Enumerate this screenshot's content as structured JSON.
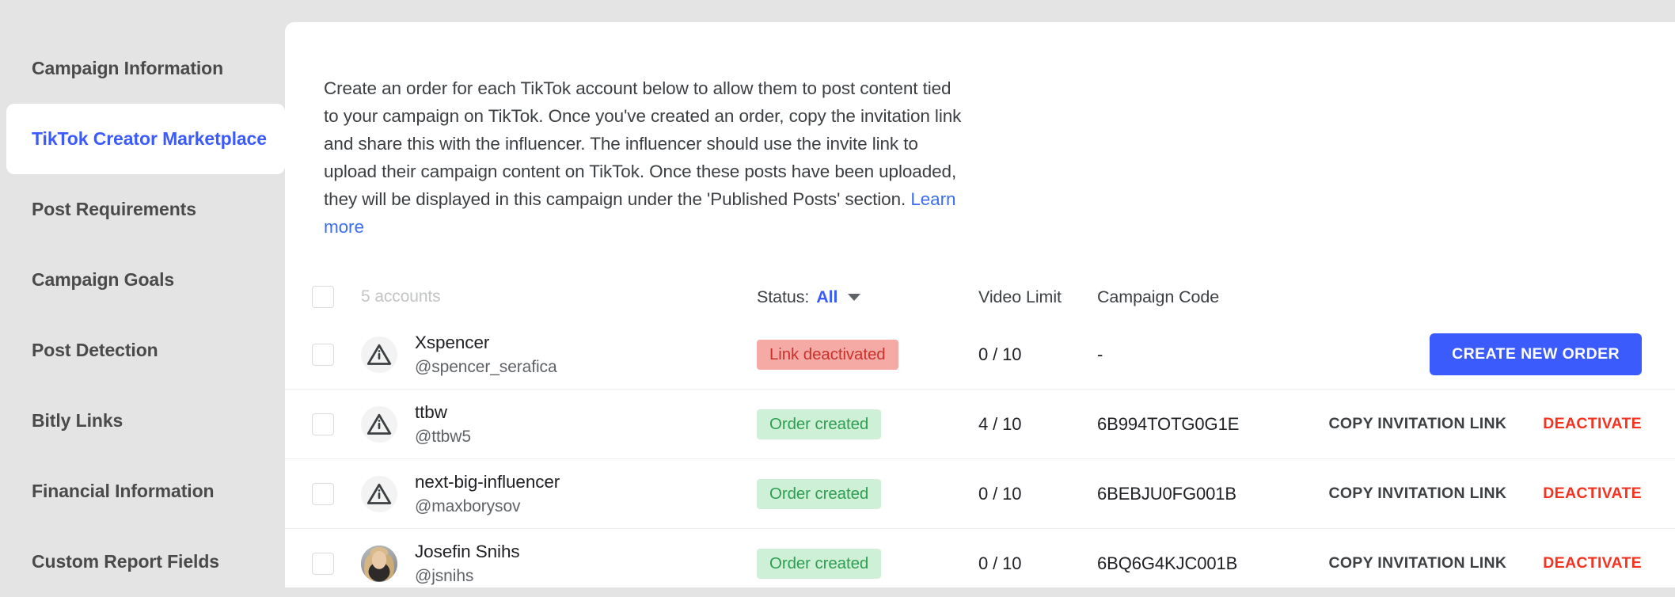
{
  "theme": {
    "accent": "#3b5bfd",
    "danger": "#f4321f",
    "link": "#3b6ef0",
    "page_bg": "#e4e4e4",
    "panel_bg": "#ffffff",
    "status_red_bg": "#f6aaa6",
    "status_red_text": "#c7322b",
    "status_green_bg": "#cdf0d7",
    "status_green_text": "#2f9e52"
  },
  "sidebar": {
    "items": [
      {
        "label": "Campaign Information",
        "active": false
      },
      {
        "label": "TikTok Creator Marketplace",
        "active": true
      },
      {
        "label": "Post Requirements",
        "active": false
      },
      {
        "label": "Campaign Goals",
        "active": false
      },
      {
        "label": "Post Detection",
        "active": false
      },
      {
        "label": "Bitly Links",
        "active": false
      },
      {
        "label": "Financial Information",
        "active": false
      },
      {
        "label": "Custom Report Fields",
        "active": false
      }
    ]
  },
  "main": {
    "intro": {
      "text": "Create an order for each TikTok account below to allow them to post content tied to your campaign on TikTok. Once you've created an order, copy the invitation link and share this with the influencer. The influencer should use the invite link to upload their campaign content on TikTok. Once these posts have been uploaded, they will be displayed in this campaign under the 'Published Posts' section. ",
      "link_label": "Learn more"
    },
    "table": {
      "header": {
        "account_count": "5 accounts",
        "status_label": "Status:",
        "status_value": "All",
        "video_limit": "Video Limit",
        "campaign_code": "Campaign Code"
      },
      "actions": {
        "create_new_order": "CREATE NEW ORDER",
        "copy_invitation_link": "COPY INVITATION LINK",
        "deactivate": "DEACTIVATE"
      },
      "rows": [
        {
          "avatar_type": "warning-icon",
          "name": "Xspencer",
          "handle": "@spencer_serafica",
          "status": "Link deactivated",
          "status_kind": "red",
          "video_limit": "0 / 10",
          "campaign_code": "-",
          "action_kind": "create"
        },
        {
          "avatar_type": "warning-icon",
          "name": "ttbw",
          "handle": "@ttbw5",
          "status": "Order created",
          "status_kind": "green",
          "video_limit": "4 / 10",
          "campaign_code": "6B994TOTG0G1E",
          "action_kind": "links"
        },
        {
          "avatar_type": "warning-icon",
          "name": "next-big-influencer",
          "handle": "@maxborysov",
          "status": "Order created",
          "status_kind": "green",
          "video_limit": "0 / 10",
          "campaign_code": "6BEBJU0FG001B",
          "action_kind": "links"
        },
        {
          "avatar_type": "photo",
          "name": "Josefin Snihs",
          "handle": "@jsnihs",
          "status": "Order created",
          "status_kind": "green",
          "video_limit": "0 / 10",
          "campaign_code": "6BQ6G4KJC001B",
          "action_kind": "links"
        }
      ]
    }
  }
}
